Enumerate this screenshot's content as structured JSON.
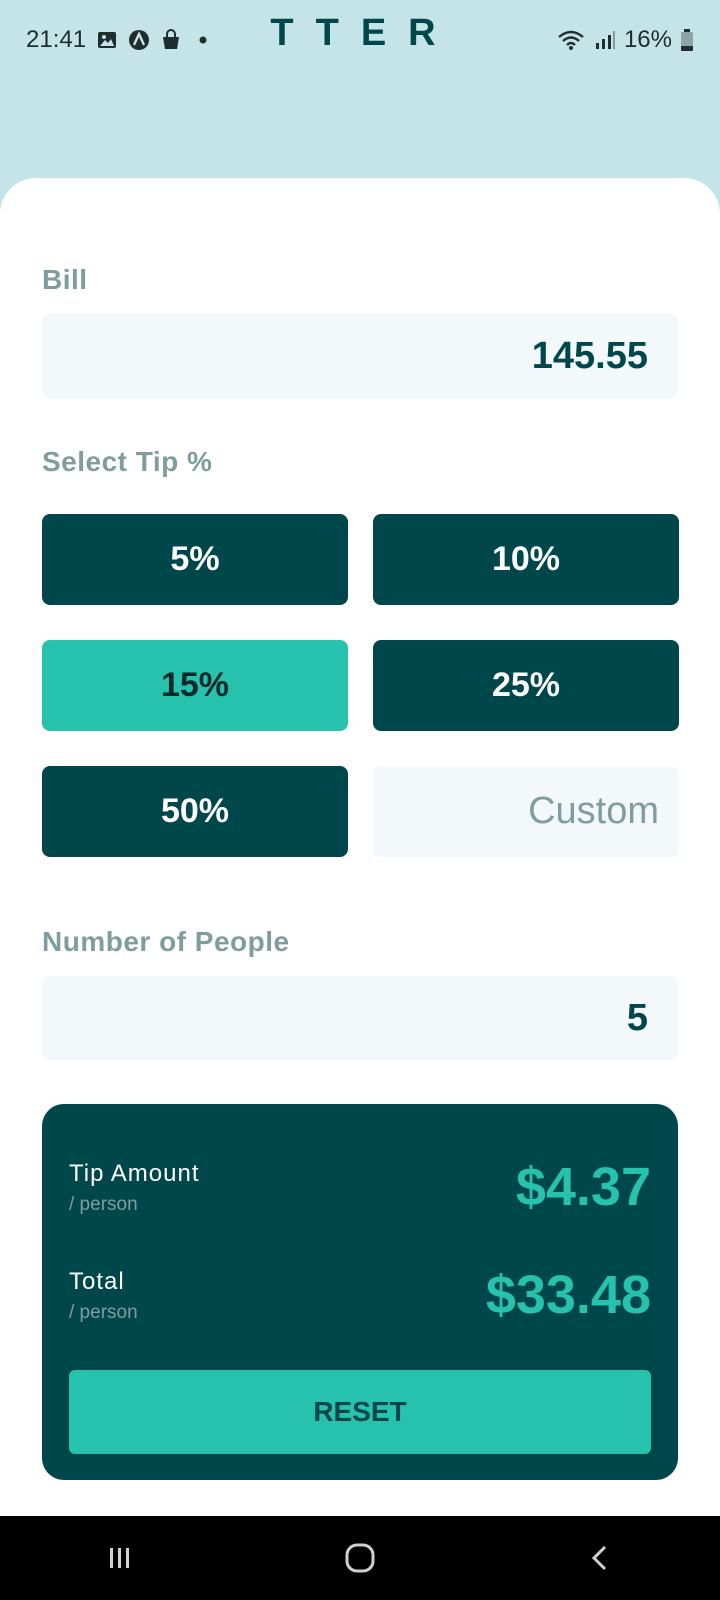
{
  "status_bar": {
    "time": "21:41",
    "battery": "16%",
    "icons_left": [
      "gallery-icon",
      "a-badge-icon",
      "shopping-bag-icon",
      "dot-icon"
    ],
    "icons_right": [
      "wifi-icon",
      "signal-icon",
      "battery-icon"
    ]
  },
  "app": {
    "logo": "TTER"
  },
  "bill": {
    "label": "Bill",
    "value": "145.55"
  },
  "tip": {
    "label": "Select Tip %",
    "options": [
      "5%",
      "10%",
      "15%",
      "25%",
      "50%"
    ],
    "selected": "15%",
    "custom_placeholder": "Custom"
  },
  "people": {
    "label": "Number of People",
    "value": "5"
  },
  "results": {
    "tip_title": "Tip Amount",
    "tip_sub": "/ person",
    "tip_value": "$4.37",
    "total_title": "Total",
    "total_sub": "/ person",
    "total_value": "$33.48",
    "reset_label": "RESET"
  },
  "colors": {
    "background": "#c5e4e7",
    "dark_cyan": "#00474b",
    "strong_cyan": "#26c2ae",
    "grayish_cyan": "#7f9d9f",
    "input_bg": "#f3f9fa"
  }
}
